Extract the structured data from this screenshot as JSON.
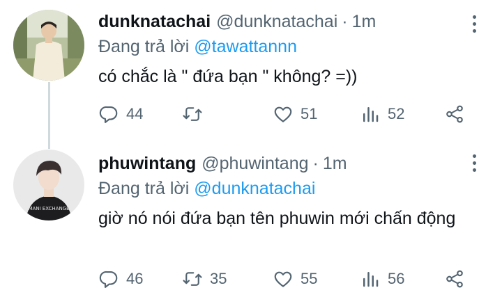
{
  "tweets": [
    {
      "display_name": "dunknatachai",
      "handle": "@dunknatachai",
      "separator": "·",
      "time": "1m",
      "reply_prefix": "Đang trả lời",
      "reply_to": "@tawattannn",
      "text": "có chắc là \" đứa bạn \" không? =))",
      "replies": "44",
      "retweets": "",
      "likes": "51",
      "views": "52"
    },
    {
      "display_name": "phuwintang",
      "handle": "@phuwintang",
      "separator": "·",
      "time": "1m",
      "reply_prefix": "Đang trả lời",
      "reply_to": "@dunknatachai",
      "text": "giờ nó nói đứa bạn tên phuwin mới chấn động",
      "replies": "46",
      "retweets": "35",
      "likes": "55",
      "views": "56"
    }
  ],
  "icons": {
    "reply": "reply-icon",
    "retweet": "retweet-icon",
    "like": "heart-icon",
    "views": "views-icon",
    "share": "share-icon",
    "more": "more-icon"
  },
  "colors": {
    "text": "#0f1419",
    "secondary": "#536471",
    "link": "#1d9bf0",
    "thread_line": "#cfd9de"
  }
}
